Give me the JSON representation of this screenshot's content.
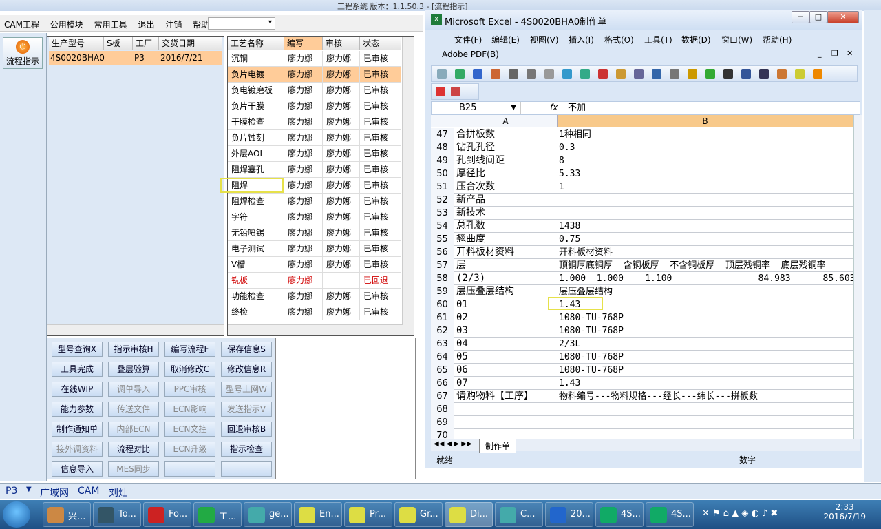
{
  "app": {
    "title": "工程系统   版本：1.1.50.3 - [流程指示]",
    "menu": [
      "CAM工程",
      "公用模块",
      "常用工具",
      "退出",
      "注销",
      "帮助"
    ],
    "combo_value": ""
  },
  "left": {
    "flow_button": "流程指示"
  },
  "product_grid": {
    "headers": [
      "生产型号",
      "S板",
      "工厂",
      "交货日期"
    ],
    "row": {
      "model": "4S0020BHA0",
      "s": "",
      "factory": "P3",
      "date": "2016/7/21"
    }
  },
  "process_grid": {
    "headers": [
      "工艺名称",
      "编写",
      "审核",
      "状态"
    ],
    "rows": [
      {
        "name": "沉铜",
        "writer": "廖力娜",
        "reviewer": "廖力娜",
        "status": "已审核"
      },
      {
        "name": "负片电镀",
        "writer": "廖力娜",
        "reviewer": "廖力娜",
        "status": "已审核"
      },
      {
        "name": "负电镀磨板",
        "writer": "廖力娜",
        "reviewer": "廖力娜",
        "status": "已审核"
      },
      {
        "name": "负片干膜",
        "writer": "廖力娜",
        "reviewer": "廖力娜",
        "status": "已审核"
      },
      {
        "name": "干膜检查",
        "writer": "廖力娜",
        "reviewer": "廖力娜",
        "status": "已审核"
      },
      {
        "name": "负片蚀刻",
        "writer": "廖力娜",
        "reviewer": "廖力娜",
        "status": "已审核"
      },
      {
        "name": "外层AOI",
        "writer": "廖力娜",
        "reviewer": "廖力娜",
        "status": "已审核"
      },
      {
        "name": "阻焊塞孔",
        "writer": "廖力娜",
        "reviewer": "廖力娜",
        "status": "已审核"
      },
      {
        "name": "阻焊",
        "writer": "廖力娜",
        "reviewer": "廖力娜",
        "status": "已审核"
      },
      {
        "name": "阻焊检查",
        "writer": "廖力娜",
        "reviewer": "廖力娜",
        "status": "已审核"
      },
      {
        "name": "字符",
        "writer": "廖力娜",
        "reviewer": "廖力娜",
        "status": "已审核"
      },
      {
        "name": "无铅喷锡",
        "writer": "廖力娜",
        "reviewer": "廖力娜",
        "status": "已审核"
      },
      {
        "name": "电子测试",
        "writer": "廖力娜",
        "reviewer": "廖力娜",
        "status": "已审核"
      },
      {
        "name": "V槽",
        "writer": "廖力娜",
        "reviewer": "廖力娜",
        "status": "已审核"
      },
      {
        "name": "铣板",
        "writer": "廖力娜",
        "reviewer": "",
        "status": "已回退"
      },
      {
        "name": "功能检查",
        "writer": "廖力娜",
        "reviewer": "廖力娜",
        "status": "已审核"
      },
      {
        "name": "终检",
        "writer": "廖力娜",
        "reviewer": "廖力娜",
        "status": "已审核"
      }
    ]
  },
  "buttons": [
    [
      "型号查询X",
      "指示审核H",
      "编写流程F",
      "保存信息S"
    ],
    [
      "工具完成",
      "叠层验算",
      "取消修改C",
      "修改信息R"
    ],
    [
      "在线WIP",
      "调单导入",
      "PPC审核",
      "型号上网W"
    ],
    [
      "能力参数",
      "传送文件",
      "ECN影响",
      "发送指示V"
    ],
    [
      "制作通知单",
      "内部ECN",
      "ECN文控",
      "回退审核B"
    ],
    [
      "接外调资料",
      "流程对比",
      "ECN升级",
      "指示检查"
    ],
    [
      "信息导入",
      "MES同步",
      "",
      ""
    ]
  ],
  "buttons_disabled": [
    [
      false,
      false,
      false,
      false
    ],
    [
      false,
      false,
      false,
      false
    ],
    [
      false,
      true,
      true,
      true
    ],
    [
      false,
      true,
      true,
      true
    ],
    [
      false,
      true,
      true,
      false
    ],
    [
      true,
      false,
      true,
      false
    ],
    [
      false,
      true,
      false,
      false
    ]
  ],
  "status": {
    "plant": "P3",
    "net": "广域网",
    "dept": "CAM",
    "user": "刘灿"
  },
  "excel": {
    "title": "Microsoft Excel - 4S0020BHA0制作单",
    "menu": [
      "文件(F)",
      "编辑(E)",
      "视图(V)",
      "插入(I)",
      "格式(O)",
      "工具(T)",
      "数据(D)",
      "窗口(W)",
      "帮助(H)"
    ],
    "menu2": "Adobe PDF(B)",
    "name_box": "B25",
    "fx": "fx",
    "formula": "不加",
    "col_a": "A",
    "col_b": "B",
    "rows": [
      {
        "n": "47",
        "a": "合拼板数",
        "b": "1种相同"
      },
      {
        "n": "48",
        "a": "钻孔孔径",
        "b": "0.3"
      },
      {
        "n": "49",
        "a": "孔到线间距",
        "b": "8"
      },
      {
        "n": "50",
        "a": "厚径比",
        "b": "5.33"
      },
      {
        "n": "51",
        "a": "压合次数",
        "b": "1"
      },
      {
        "n": "52",
        "a": "新产品",
        "b": ""
      },
      {
        "n": "53",
        "a": "新技术",
        "b": ""
      },
      {
        "n": "54",
        "a": "总孔数",
        "b": "1438"
      },
      {
        "n": "55",
        "a": "翘曲度",
        "b": "0.75"
      },
      {
        "n": "56",
        "a": "开料板材资料",
        "b": "开料板材资料"
      },
      {
        "n": "57",
        "a": "层",
        "b": "顶铜厚底铜厚  含铜板厚  不含铜板厚  顶层残铜率  底层残铜率"
      },
      {
        "n": "58",
        "a": "(2/3)",
        "b": "1.000  1.000    1.100                84.983      85.603"
      },
      {
        "n": "59",
        "a": "层压叠层结构",
        "b": "层压叠层结构"
      },
      {
        "n": "60",
        "a": "01",
        "b": "1.43"
      },
      {
        "n": "61",
        "a": "02",
        "b": "1080-TU-768P"
      },
      {
        "n": "62",
        "a": "03",
        "b": "1080-TU-768P"
      },
      {
        "n": "63",
        "a": "04",
        "b": "2/3L"
      },
      {
        "n": "64",
        "a": "05",
        "b": "1080-TU-768P"
      },
      {
        "n": "65",
        "a": "06",
        "b": "1080-TU-768P"
      },
      {
        "n": "66",
        "a": "07",
        "b": "1.43"
      },
      {
        "n": "67",
        "a": "请购物料【工序】",
        "b": "物料编号---物料规格---经长---纬长---拼板数"
      },
      {
        "n": "68",
        "a": "",
        "b": ""
      },
      {
        "n": "69",
        "a": "",
        "b": ""
      },
      {
        "n": "70",
        "a": "",
        "b": ""
      }
    ],
    "sheet_tab": "制作单",
    "status_left": "就绪",
    "status_right": "数字"
  },
  "taskbar": {
    "items": [
      "兴...",
      "To...",
      "Fo...",
      "工...",
      "ge...",
      "En...",
      "Pr...",
      "Gr...",
      "Di...",
      "C...",
      "20...",
      "4S...",
      "4S..."
    ],
    "time": "2:33",
    "date": "2016/7/19"
  },
  "colors": {
    "accent": "#ffcc99",
    "highlight": "#e6e14a",
    "red": "#d00000"
  }
}
